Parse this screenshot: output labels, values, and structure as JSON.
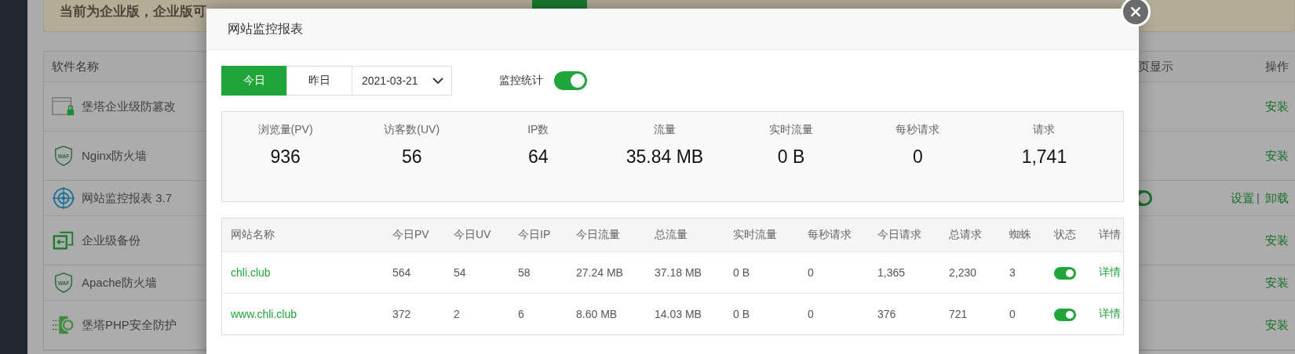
{
  "banner": {
    "text": "当前为企业版，企业版可"
  },
  "software_table": {
    "columns": [
      "软件名称",
      "页显示",
      "操作"
    ],
    "action_separator": "|",
    "rows": [
      {
        "name": "堡塔企业级防篡改",
        "kind": "available",
        "actions": [
          "安装"
        ]
      },
      {
        "name": "Nginx防火墙",
        "kind": "available",
        "icon_text": "WAF",
        "actions": [
          "安装"
        ]
      },
      {
        "name": "网站监控报表 3.7",
        "kind": "installed",
        "home_display": true,
        "actions": [
          "设置",
          "卸载"
        ]
      },
      {
        "name": "企业级备份",
        "kind": "available",
        "actions": [
          "安装"
        ]
      },
      {
        "name": "Apache防火墙",
        "kind": "available",
        "icon_text": "WAF",
        "actions": [
          "安装"
        ]
      },
      {
        "name": "堡塔PHP安全防护",
        "kind": "available",
        "actions": [
          "安装"
        ]
      }
    ]
  },
  "modal": {
    "title": "网站监控报表",
    "day_tabs": [
      {
        "label": "今日",
        "selected": true
      },
      {
        "label": "昨日",
        "selected": false
      }
    ],
    "date": "2021-03-21",
    "monitor_toggle": {
      "label": "监控统计",
      "on": true
    },
    "stats": [
      {
        "label": "浏览量(PV)",
        "value": "936"
      },
      {
        "label": "访客数(UV)",
        "value": "56"
      },
      {
        "label": "IP数",
        "value": "64"
      },
      {
        "label": "流量",
        "value": "35.84 MB"
      },
      {
        "label": "实时流量",
        "value": "0 B"
      },
      {
        "label": "每秒请求",
        "value": "0"
      },
      {
        "label": "请求",
        "value": "1,741"
      }
    ],
    "sites_table": {
      "columns": [
        "网站名称",
        "今日PV",
        "今日UV",
        "今日IP",
        "今日流量",
        "总流量",
        "实时流量",
        "每秒请求",
        "今日请求",
        "总请求",
        "蜘蛛",
        "状态",
        "详情"
      ],
      "rows": [
        {
          "cells": [
            "chli.club",
            "564",
            "54",
            "58",
            "27.24 MB",
            "37.18 MB",
            "0 B",
            "0",
            "1,365",
            "2,230",
            "3"
          ],
          "status_on": true,
          "detail": "详情"
        },
        {
          "cells": [
            "www.chli.club",
            "372",
            "2",
            "6",
            "8.60 MB",
            "14.03 MB",
            "0 B",
            "0",
            "376",
            "721",
            "0"
          ],
          "status_on": true,
          "detail": "详情"
        }
      ]
    }
  }
}
